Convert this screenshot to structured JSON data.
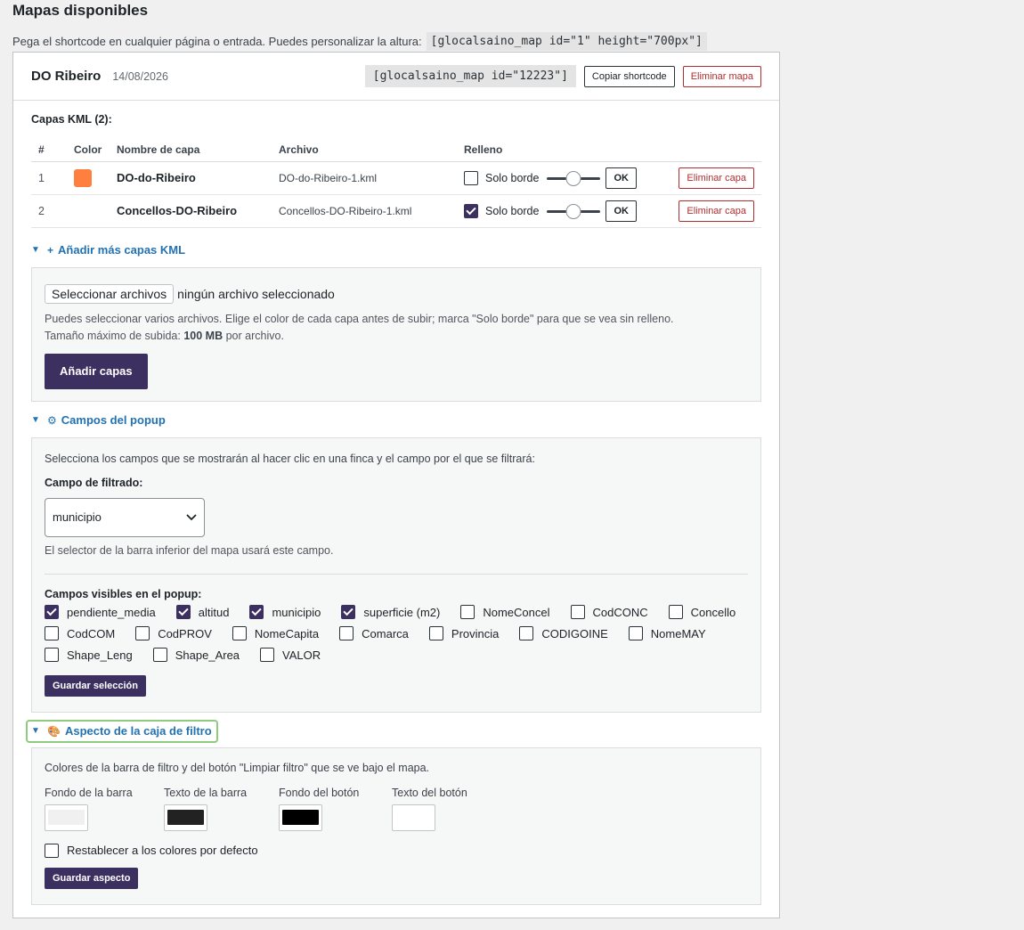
{
  "page": {
    "title": "Mapas disponibles",
    "intro": "Pega el shortcode en cualquier página o entrada. Puedes personalizar la altura:",
    "intro_code": "[glocalsaino_map id=\"1\" height=\"700px\"]"
  },
  "map": {
    "name": "DO Ribeiro",
    "date": "14/08/2026",
    "shortcode": "[glocalsaino_map id=\"12223\"]",
    "copy_label": "Copiar shortcode",
    "delete_label": "Eliminar mapa"
  },
  "layers": {
    "heading": "Capas KML (2):",
    "columns": [
      "#",
      "Color",
      "Nombre de capa",
      "Archivo",
      "Relleno"
    ],
    "fill_label": "Solo borde",
    "ok_label": "OK",
    "delete_label": "Eliminar capa",
    "rows": [
      {
        "num": "1",
        "color": "#ff7f3f",
        "name": "DO-do-Ribeiro",
        "file": "DO-do-Ribeiro-1.kml",
        "solo_borde": false,
        "opacity": 0.5
      },
      {
        "num": "2",
        "color": "",
        "name": "Concellos-DO-Ribeiro",
        "file": "Concellos-DO-Ribeiro-1.kml",
        "solo_borde": true,
        "opacity": 0.5
      }
    ]
  },
  "add_layers": {
    "toggle": "Añadir más capas KML",
    "file_button": "Seleccionar archivos",
    "file_status": "ningún archivo seleccionado",
    "help1": "Puedes seleccionar varios archivos. Elige el color de cada capa antes de subir; marca \"Solo borde\" para que se vea sin relleno.",
    "help2_pre": "Tamaño máximo de subida:",
    "help2_bold": "100 MB",
    "help2_post": "por archivo.",
    "submit": "Añadir capas"
  },
  "popup": {
    "toggle": "Campos del popup",
    "intro": "Selecciona los campos que se mostrarán al hacer clic en una finca y el campo por el que se filtrará:",
    "filter_label": "Campo de filtrado:",
    "filter_value": "municipio",
    "filter_help": "El selector de la barra inferior del mapa usará este campo.",
    "visible_label": "Campos visibles en el popup:",
    "fields": [
      {
        "label": "pendiente_media",
        "checked": true
      },
      {
        "label": "altitud",
        "checked": true
      },
      {
        "label": "municipio",
        "checked": true
      },
      {
        "label": "superficie (m2)",
        "checked": true
      },
      {
        "label": "NomeConcel",
        "checked": false
      },
      {
        "label": "CodCONC",
        "checked": false
      },
      {
        "label": "Concello",
        "checked": false
      },
      {
        "label": "CodCOM",
        "checked": false
      },
      {
        "label": "CodPROV",
        "checked": false
      },
      {
        "label": "NomeCapita",
        "checked": false
      },
      {
        "label": "Comarca",
        "checked": false
      },
      {
        "label": "Provincia",
        "checked": false
      },
      {
        "label": "CODIGOINE",
        "checked": false
      },
      {
        "label": "NomeMAY",
        "checked": false
      },
      {
        "label": "Shape_Leng",
        "checked": false
      },
      {
        "label": "Shape_Area",
        "checked": false
      },
      {
        "label": "VALOR",
        "checked": false
      }
    ],
    "save": "Guardar selección"
  },
  "appearance": {
    "toggle": "Aspecto de la caja de filtro",
    "intro": "Colores de la barra de filtro y del botón \"Limpiar filtro\" que se ve bajo el mapa.",
    "colors": [
      {
        "label": "Fondo de la barra",
        "value": "#f0f0f1"
      },
      {
        "label": "Texto de la barra",
        "value": "#222222"
      },
      {
        "label": "Fondo del botón",
        "value": "#000000"
      },
      {
        "label": "Texto del botón",
        "value": "#ffffff"
      }
    ],
    "reset_label": "Restablecer a los colores por defecto",
    "save": "Guardar aspecto"
  }
}
